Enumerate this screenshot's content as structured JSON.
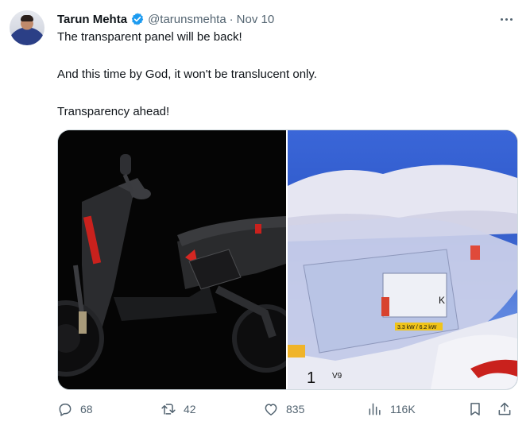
{
  "tweet": {
    "author_name": "Tarun Mehta",
    "handle": "@tarunsmehta",
    "separator": "·",
    "timestamp": "Nov 10",
    "paragraphs": [
      "The transparent panel will be back!",
      "And this time by God, it won't be translucent only.",
      "Transparency ahead!"
    ],
    "verified_color": "#1d9bf0"
  },
  "media": {
    "left_image": "black-scooter-photo",
    "right_image": "transparent-panel-closeup-photo",
    "right_image_labels": {
      "battery_spec": "3.3 kW / 6.2 kW",
      "number_1": "1",
      "model": "V9",
      "letter": "K"
    }
  },
  "actions": {
    "replies": "68",
    "reposts": "42",
    "likes": "835",
    "views": "116K"
  },
  "icons": [
    "more-icon",
    "verified-icon",
    "reply-icon",
    "repost-icon",
    "like-icon",
    "views-icon",
    "bookmark-icon",
    "share-icon"
  ]
}
